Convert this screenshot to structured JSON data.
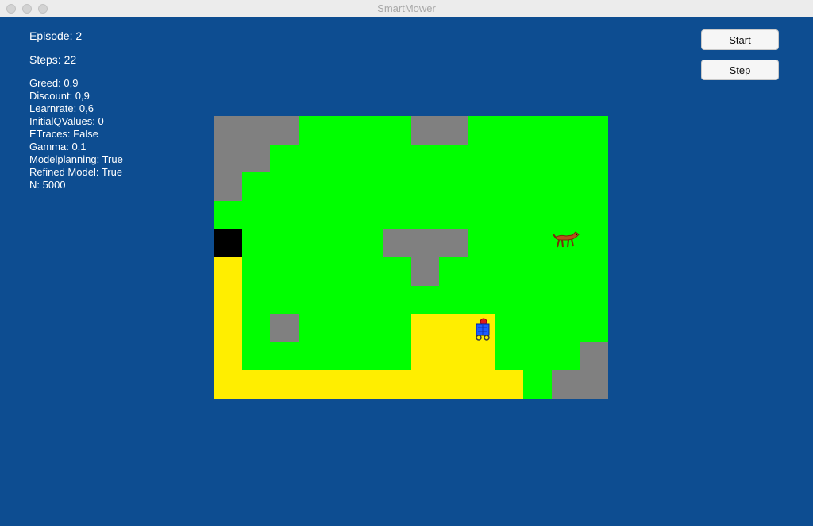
{
  "window": {
    "title": "SmartMower"
  },
  "stats": {
    "episode": "Episode: 2",
    "steps": "Steps: 22"
  },
  "params": [
    "Greed: 0,9",
    "Discount: 0,9",
    "Learnrate: 0,6",
    "InitialQValues: 0",
    "ETraces: False",
    "Gamma: 0,1",
    "Modelplanning: True",
    "Refined Model: True",
    "N: 5000"
  ],
  "buttons": {
    "start": "Start",
    "step": "Step"
  },
  "colors": {
    "background": "#0d4d91",
    "grass": "#00ff00",
    "rock": "#808080",
    "mowed": "#ffee00",
    "hole": "#000000"
  },
  "icons": {
    "mower": "mower-icon",
    "dog": "dog-icon"
  }
}
